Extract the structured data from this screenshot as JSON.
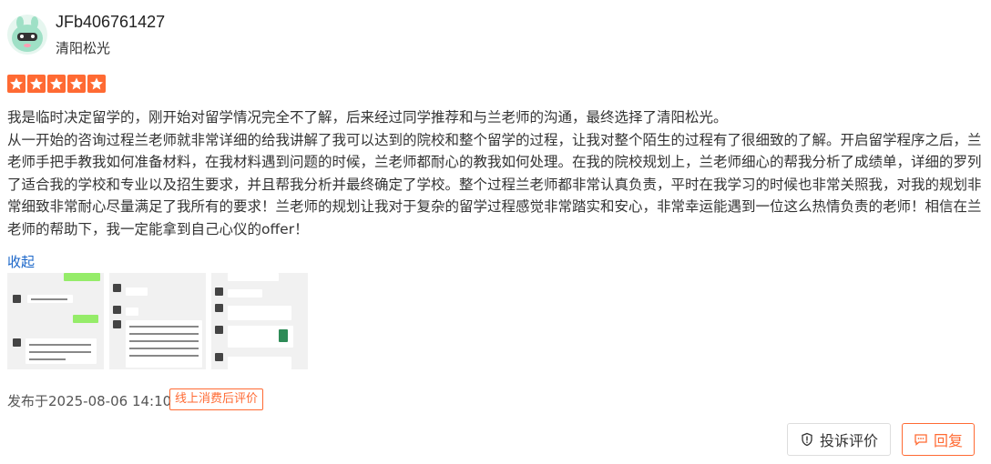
{
  "user": {
    "name": "JFb406761427",
    "shop": "清阳松光"
  },
  "rating": {
    "stars": 5,
    "max": 5,
    "color": "#ff6a33"
  },
  "review": {
    "paragraphs": [
      "我是临时决定留学的，刚开始对留学情况完全不了解，后来经过同学推荐和与兰老师的沟通，最终选择了清阳松光。",
      "从一开始的咨询过程兰老师就非常详细的给我讲解了我可以达到的院校和整个留学的过程，让我对整个陌生的过程有了很细致的了解。开启留学程序之后，兰老师手把手教我如何准备材料，在我材料遇到问题的时候，兰老师都耐心的教我如何处理。在我的院校规划上，兰老师细心的帮我分析了成绩单，详细的罗列了适合我的学校和专业以及招生要求，并且帮我分析并最终确定了学校。整个过程兰老师都非常认真负责，平时在我学习的时候也非常关照我，对我的规划非常细致非常耐心尽量满足了我所有的要求！兰老师的规划让我对于复杂的留学过程感觉非常踏实和安心，非常幸运能遇到一位这么热情负责的老师！相信在兰老师的帮助下，我一定能拿到自己心仪的offer！"
    ],
    "collapse_label": "收起"
  },
  "images": [
    {
      "name": "chat-screenshot-1"
    },
    {
      "name": "chat-screenshot-2"
    },
    {
      "name": "chat-screenshot-3"
    }
  ],
  "meta": {
    "published": "发布于2025-08-06 14:10",
    "tag": "线上消费后评价"
  },
  "actions": {
    "complain": "投诉评价",
    "reply": "回复"
  },
  "colors": {
    "accent": "#ff6a33",
    "link": "#1a66c9"
  }
}
